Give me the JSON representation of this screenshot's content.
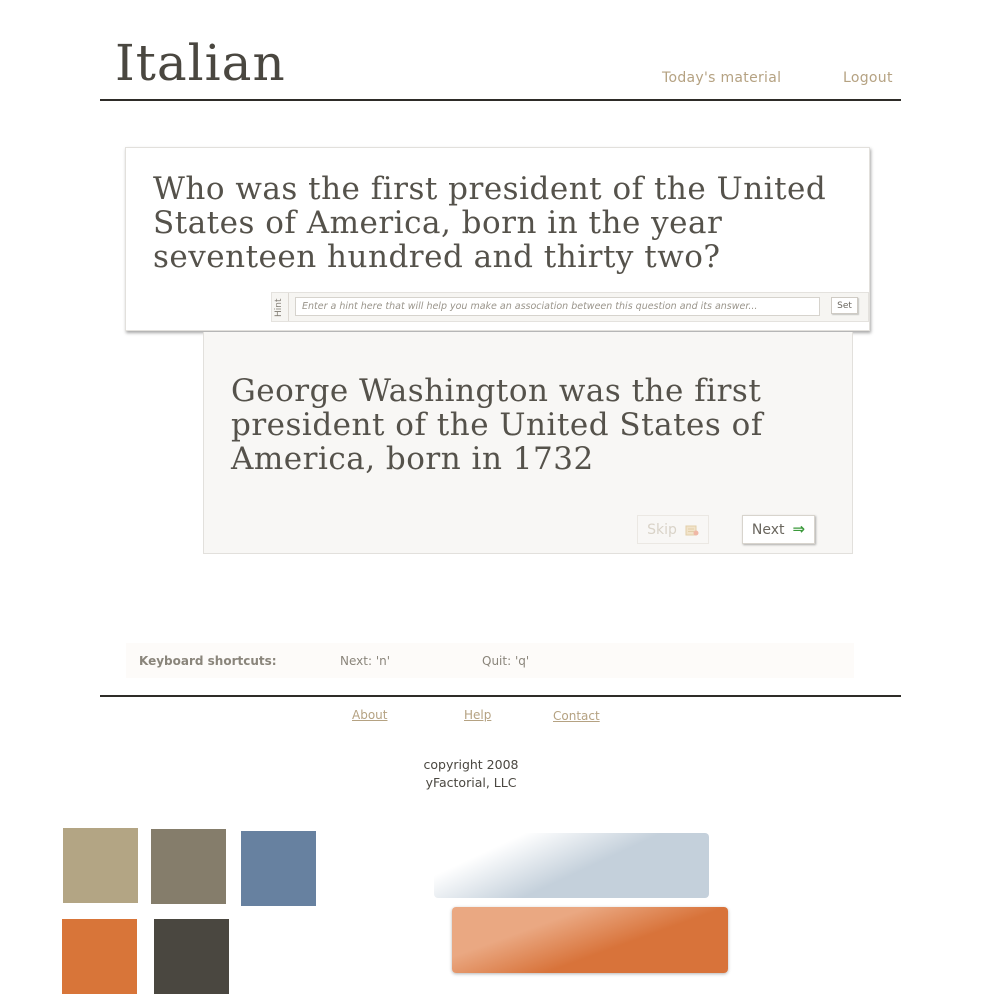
{
  "header": {
    "title": "Italian",
    "nav": [
      {
        "label": "Today's material"
      },
      {
        "label": "Logout"
      }
    ]
  },
  "question": {
    "text": "Who was the first president of the United States of America, born in the year seventeen hundred and thirty two?",
    "hint": {
      "label": "Hint",
      "placeholder": "Enter a hint here that will help you make an association between this question and its answer...",
      "set_label": "Set"
    }
  },
  "answer": {
    "text": "George Washington was the first president of the United States of America, born in 1732",
    "skip_label": "Skip",
    "skip_icon": "skip-note-icon",
    "next_label": "Next",
    "next_icon": "arrow-right-icon",
    "next_arrow": "⇒"
  },
  "shortcuts": {
    "title": "Keyboard shortcuts:",
    "next": "Next: 'n'",
    "quit": "Quit: 'q'"
  },
  "footer": {
    "links": [
      {
        "label": "About"
      },
      {
        "label": "Help"
      },
      {
        "label": "Contact"
      }
    ],
    "copyright_line1": "copyright 2008",
    "copyright_line2": "yFactorial, LLC"
  },
  "palette": {
    "swatches": [
      "#b3a584",
      "#857d6b",
      "#6781a0",
      "#d87539",
      "#4a4740"
    ],
    "gradient_blue": [
      "#ffffff",
      "#c4d0db"
    ],
    "gradient_orange": [
      "#eaa882",
      "#d8733a"
    ],
    "accent_link": "#b5a282",
    "next_arrow_color": "#3c9a3c"
  }
}
